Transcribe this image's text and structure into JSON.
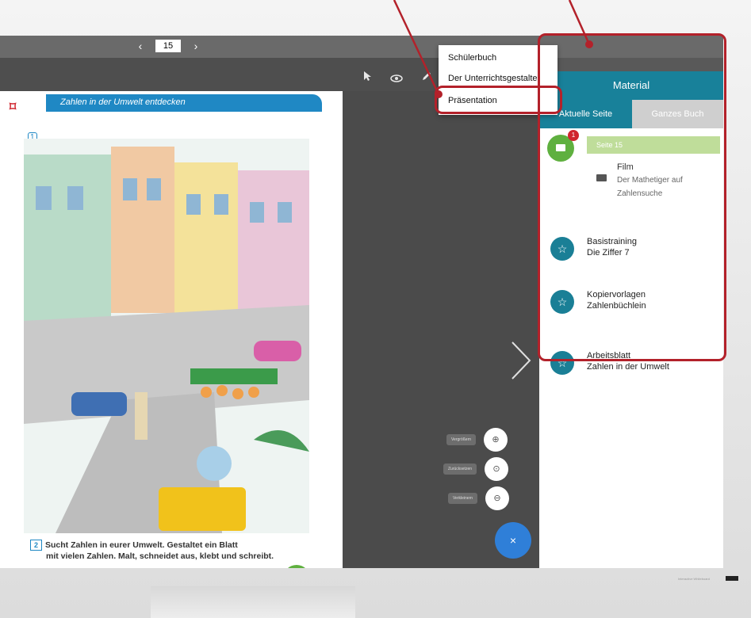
{
  "nav": {
    "prev_icon": "chevron-left",
    "page_value": "15",
    "next_icon": "chevron-right"
  },
  "toolbar": {
    "icons": [
      "pointer-icon",
      "eye-icon",
      "pen-icon"
    ]
  },
  "menu": {
    "items": [
      "Schülerbuch",
      "Der Unterrichtsgestalter",
      "Präsentation"
    ],
    "selected": "Präsentation"
  },
  "book": {
    "heading": "Zahlen in der Umwelt entdecken",
    "task2_num": "2",
    "task2_line1": "Sucht Zahlen in eurer Umwelt. Gestaltet ein Blatt",
    "task2_line2": "mit vielen Zahlen. Malt, schneidet aus, klebt und schreibt.",
    "page_number": "15"
  },
  "zoom": {
    "enlarge": "Vergrößern",
    "reset": "Zurücksetzen",
    "shrink": "Verkleinern"
  },
  "fab_icon": "×",
  "panel": {
    "title": "Material",
    "tabs": [
      "Aktuelle Seite",
      "Ganzes Buch"
    ],
    "page_label": "Seite 15",
    "badge": "1",
    "film": {
      "title": "Film",
      "desc": "Der Mathetiger auf Zahlensuche"
    },
    "items": [
      {
        "line1": "Basistraining",
        "line2": "Die Ziffer 7"
      },
      {
        "line1": "Kopiervorlagen",
        "line2": "Zahlenbüchlein"
      },
      {
        "line1": "Arbeitsblatt",
        "line2": "Zahlen in der Umwelt"
      }
    ]
  },
  "colors": {
    "accent": "#18819a",
    "highlight": "#b3212a",
    "book_band": "#1f88c4",
    "film_green": "#5fb03f",
    "fab": "#2f7fd8"
  }
}
